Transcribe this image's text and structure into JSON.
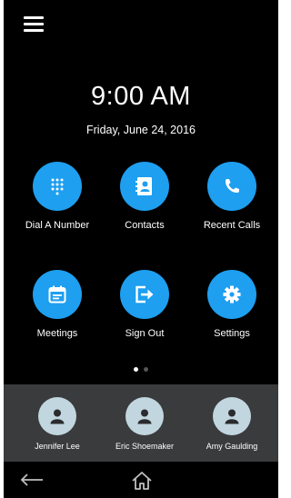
{
  "header": {
    "menu_icon": "hamburger-menu-icon"
  },
  "clock": {
    "time": "9:00 AM",
    "date": "Friday, June 24, 2016"
  },
  "apps": [
    {
      "label": "Dial A Number",
      "icon": "dialpad-icon"
    },
    {
      "label": "Contacts",
      "icon": "contact-book-icon"
    },
    {
      "label": "Recent Calls",
      "icon": "phone-icon"
    },
    {
      "label": "Meetings",
      "icon": "calendar-icon"
    },
    {
      "label": "Sign Out",
      "icon": "sign-out-icon"
    },
    {
      "label": "Settings",
      "icon": "gear-icon"
    }
  ],
  "pager": {
    "pages": 2,
    "current": 1
  },
  "favorites": [
    {
      "name": "Jennifer Lee",
      "icon": "person-icon"
    },
    {
      "name": "Eric Shoemaker",
      "icon": "person-icon"
    },
    {
      "name": "Amy Gaulding",
      "icon": "person-icon"
    }
  ],
  "nav": {
    "back_icon": "back-arrow-icon",
    "home_icon": "home-icon"
  },
  "colors": {
    "background": "#000000",
    "accent": "#1e9ff0",
    "contacts_bar": "#3a3b3d",
    "avatar": "#c2d6e0",
    "text": "#ffffff"
  }
}
